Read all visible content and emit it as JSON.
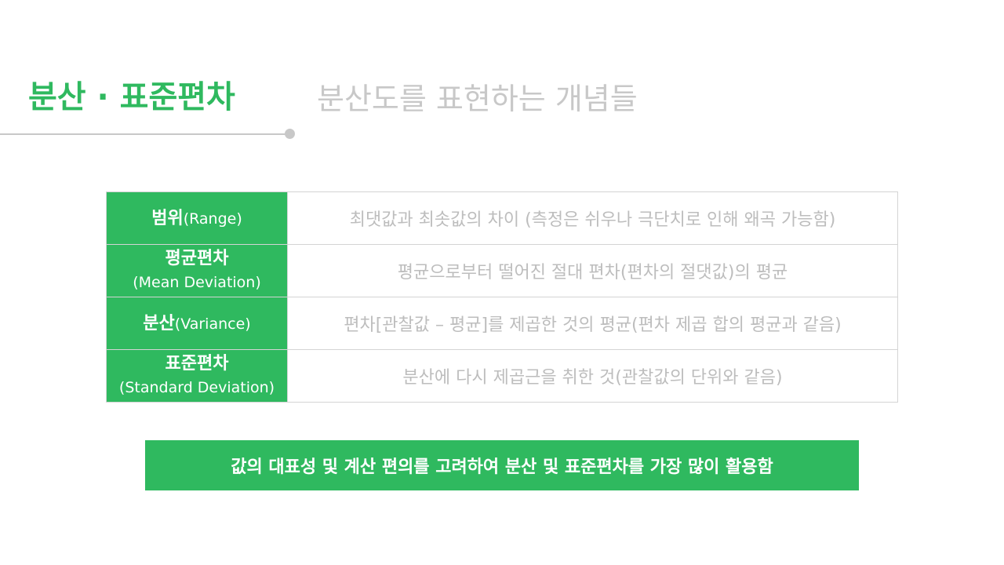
{
  "header": {
    "title": "분산 · 표준편차",
    "subtitle": "분산도를 표현하는 개념들"
  },
  "table": {
    "rows": [
      {
        "term_ko": "범위",
        "term_en": "(Range)",
        "description": "최댓값과 최솟값의 차이 (측정은 쉬우나 극단치로 인해 왜곡 가능함)"
      },
      {
        "term_ko": "평균편차",
        "term_en": "(Mean Deviation)",
        "description": "평균으로부터 떨어진 절대 편차(편차의 절댓값)의 평균"
      },
      {
        "term_ko": "분산",
        "term_en": "(Variance)",
        "description": "편차[관찰값 – 평균]를 제곱한 것의 평균(편차 제곱 합의 평균과 같음)"
      },
      {
        "term_ko": "표준편차",
        "term_en": "(Standard Deviation)",
        "description": "분산에 다시 제곱근을 취한 것(관찰값의 단위와 같음)"
      }
    ]
  },
  "summary": {
    "text": "값의 대표성 및 계산 편의를 고려하여 분산 및 표준편차를 가장 많이 활용함"
  },
  "colors": {
    "accent": "#2fb95f",
    "muted_text": "#bdbdbd",
    "rule": "#c8c8c8"
  }
}
